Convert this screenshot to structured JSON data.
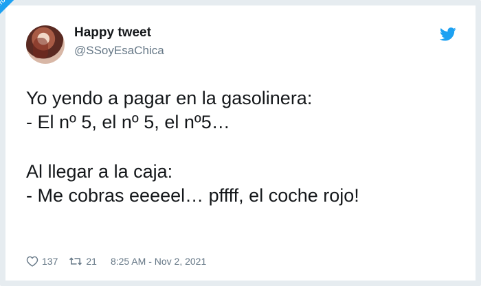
{
  "watermark": {
    "text": "VISTOENLASREDES.COM"
  },
  "user": {
    "display_name": "Happy tweet",
    "handle": "@SSoyEsaChica"
  },
  "brand": {
    "icon": "twitter-bird-icon",
    "color": "#1da1f2"
  },
  "tweet": {
    "lines": [
      "Yo yendo a pagar en la gasolinera:",
      "- El nº 5, el nº 5, el nº5…",
      "",
      "Al llegar a la caja:",
      "- Me cobras eeeeel… pffff, el coche rojo!"
    ]
  },
  "stats": {
    "likes": "137",
    "retweets": "21",
    "timestamp": "8:25 AM - Nov 2, 2021"
  }
}
